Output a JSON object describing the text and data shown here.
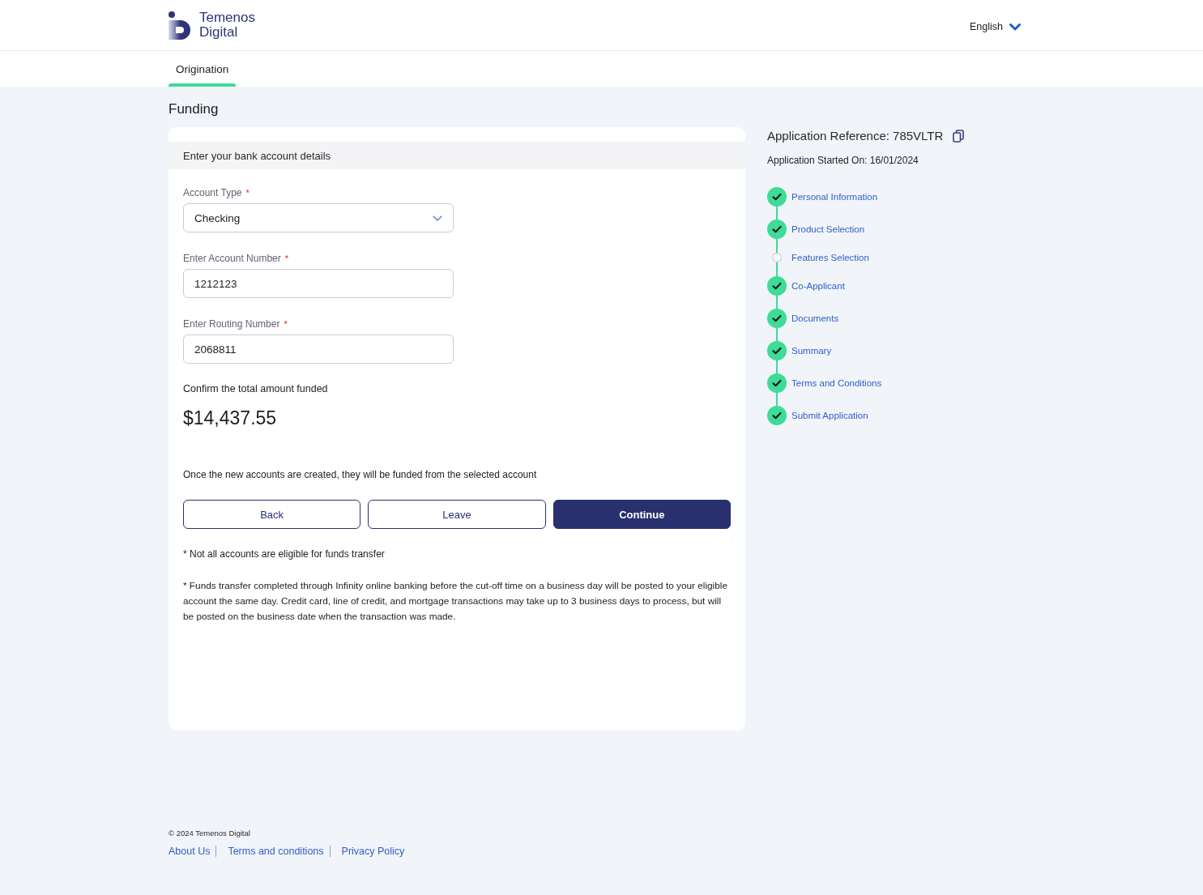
{
  "header": {
    "brand": [
      "Temenos",
      "Digital"
    ],
    "language": "English"
  },
  "tabs": [
    {
      "label": "Origination",
      "selected": true
    }
  ],
  "page_title": "Funding",
  "form": {
    "section_title": "Enter your bank account details",
    "fields": [
      {
        "kind": "select",
        "label": "Account Type",
        "required_mark": "*",
        "value": "Checking"
      },
      {
        "kind": "text",
        "label": "Enter Account Number",
        "required_mark": "*",
        "value": "1212123"
      },
      {
        "kind": "text",
        "label": "Enter Routing Number",
        "required_mark": "*",
        "value": "2068811"
      }
    ],
    "amount_label": "Confirm the total amount funded",
    "amount": "$14,437.55",
    "notice": "Once the new accounts are created, they will be funded from the selected account",
    "buttons": [
      {
        "label": "Back",
        "kind": "outline"
      },
      {
        "label": "Leave",
        "kind": "outline"
      },
      {
        "label": "Continue",
        "kind": "primary"
      }
    ],
    "footnotes": [
      "* Not all accounts are eligible for funds transfer",
      "* Funds transfer completed through Infinity online banking before the cut-off time on a business day will be posted to your eligible account the same day. Credit card, line of credit, and mortgage transactions may take up to 3 business days to process, but will be posted on the business date when the transaction was made."
    ]
  },
  "application": {
    "reference": "Application Reference: 785VLTR",
    "started": "Application Started On: 16/01/2024",
    "steps": [
      {
        "label": "Personal Information",
        "done": true
      },
      {
        "label": "Product Selection",
        "done": true
      },
      {
        "label": "Features Selection",
        "done": false
      },
      {
        "label": "Co-Applicant",
        "done": true
      },
      {
        "label": "Documents",
        "done": true
      },
      {
        "label": "Summary",
        "done": true
      },
      {
        "label": "Terms and Conditions",
        "done": true
      },
      {
        "label": "Submit Application",
        "done": true
      }
    ]
  },
  "footer": {
    "copyright": "© 2024 Temenos Digital",
    "links": [
      "About Us",
      "Terms and conditions",
      "Privacy Policy"
    ]
  }
}
